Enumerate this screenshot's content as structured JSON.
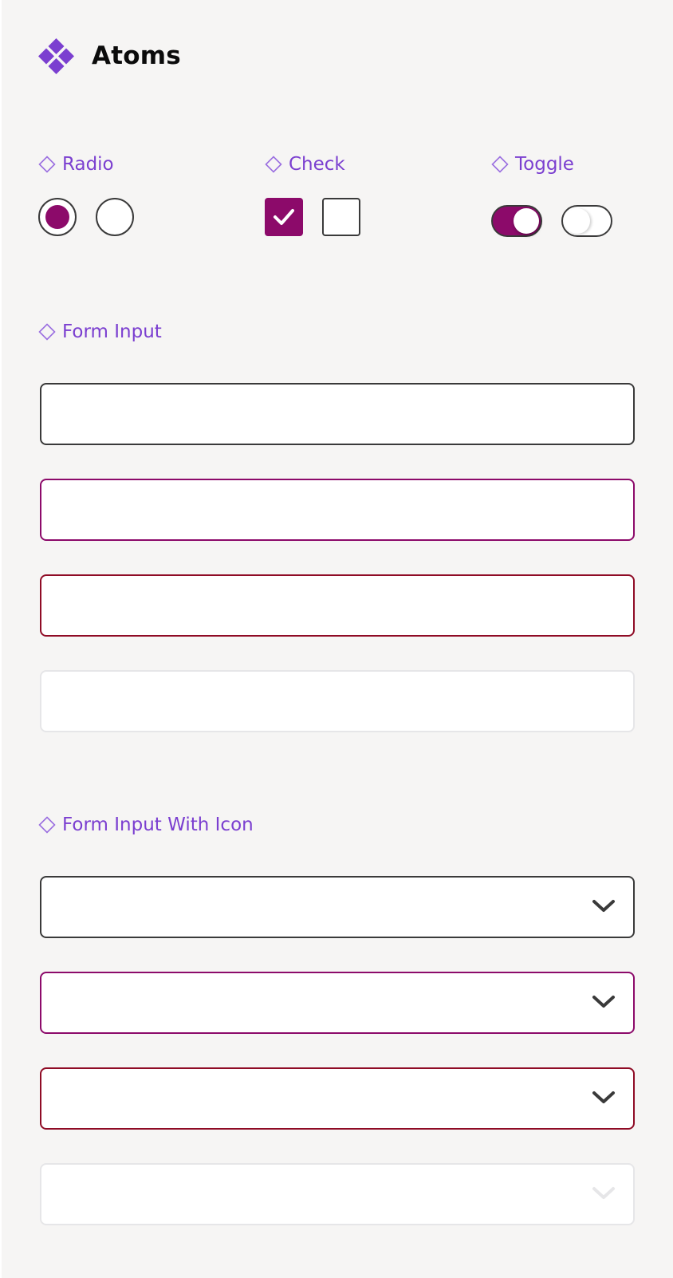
{
  "header": {
    "title": "Atoms",
    "logo_icon": "diamond-cluster-icon"
  },
  "sections": {
    "radio": {
      "label": "Radio",
      "selected": true,
      "unselected": false
    },
    "check": {
      "label": "Check",
      "checked": true,
      "unchecked": false
    },
    "toggle": {
      "label": "Toggle",
      "on": true,
      "off": false
    },
    "form_input": {
      "label": "Form Input",
      "states": [
        "default",
        "focused",
        "error",
        "disabled"
      ]
    },
    "form_input_icon": {
      "label": "Form Input With Icon",
      "icon": "chevron-down-icon",
      "states": [
        "default",
        "focused",
        "error",
        "disabled"
      ]
    }
  },
  "colors": {
    "accent": "#7b3fd0",
    "primary": "#8c0a6a",
    "error": "#8f0b25",
    "border": "#3a3a3a",
    "disabled_border": "#e6e6e8",
    "background": "#f6f5f4"
  }
}
